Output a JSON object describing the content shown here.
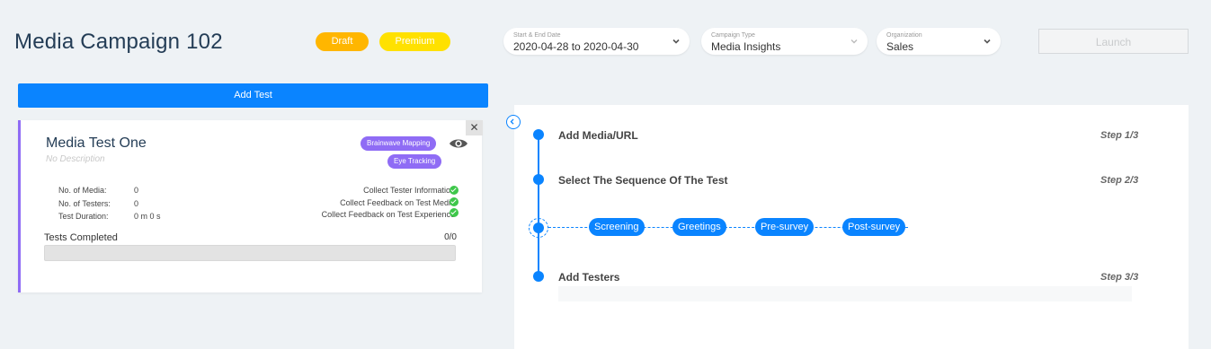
{
  "header": {
    "title": "Media Campaign 102",
    "badges": {
      "draft": "Draft",
      "premium": "Premium"
    },
    "date_select": {
      "label": "Start & End Date",
      "value": "2020-04-28 to 2020-04-30"
    },
    "type_select": {
      "label": "Campaign Type",
      "value": "Media Insights"
    },
    "org_select": {
      "label": "Organization",
      "value": "Sales"
    },
    "launch_label": "Launch"
  },
  "add_test_label": "Add Test",
  "test_card": {
    "title": "Media Test One",
    "description": "No Description",
    "tags": [
      "Brainwave Mapping",
      "Eye Tracking"
    ],
    "stats": [
      {
        "label": "No. of Media:",
        "value": "0"
      },
      {
        "label": "No. of Testers:",
        "value": "0"
      },
      {
        "label": "Test Duration:",
        "value": "0 m 0 s"
      }
    ],
    "features": [
      "Collect Tester Information",
      "Collect Feedback on Test Media",
      "Collect Feedback on Test Experience"
    ],
    "tests_completed_label": "Tests Completed",
    "tests_completed_value": "0/0",
    "progress": 0,
    "close_glyph": "✕"
  },
  "steps": {
    "step1": {
      "label": "Add Media/URL",
      "tag": "Step 1/3"
    },
    "step2": {
      "label": "Select The Sequence Of The Test",
      "tag": "Step 2/3"
    },
    "sequence": [
      "Screening",
      "Greetings",
      "Pre-survey",
      "Post-survey"
    ],
    "step3": {
      "label": "Add Testers",
      "tag": "Step 3/3"
    }
  },
  "colors": {
    "accent": "#0a84ff",
    "draft": "#ffb600",
    "premium": "#ffe100",
    "purple": "#8f6cf5",
    "check": "#3ec74a"
  },
  "icons": [
    "chevron-down-icon",
    "eye-icon",
    "close-icon",
    "check-icon",
    "chevron-left-icon"
  ]
}
